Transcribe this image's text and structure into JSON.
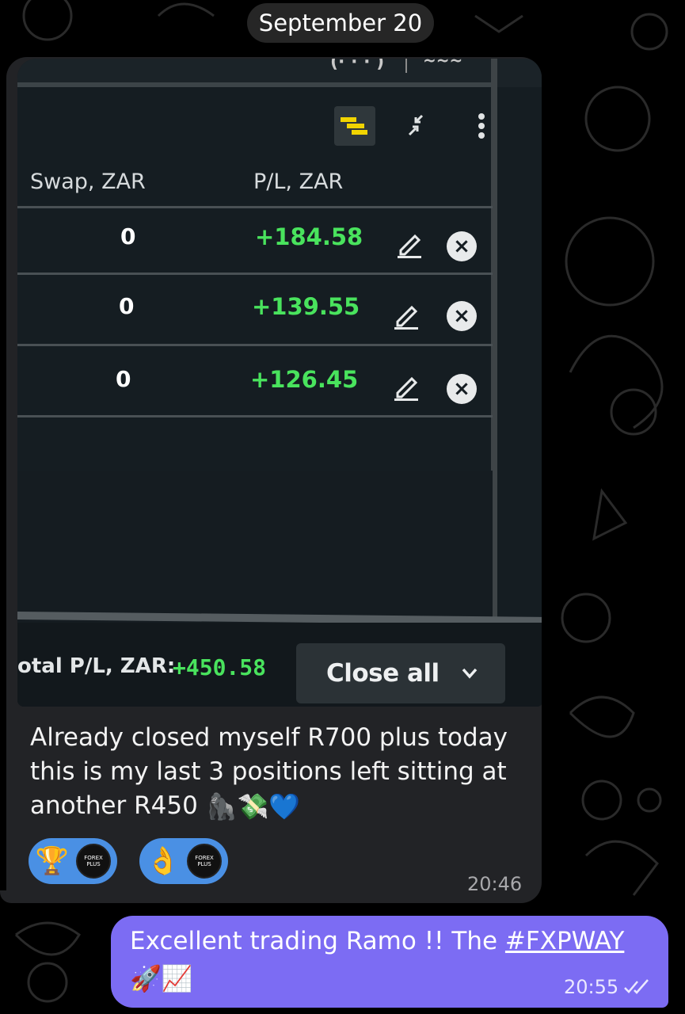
{
  "chat": {
    "date_label": "September 20",
    "incoming": {
      "screenshot": {
        "col_swap": "Swap, ZAR",
        "col_pl": "P/L, ZAR",
        "rows": [
          {
            "swap": "0",
            "pl": "+184.58"
          },
          {
            "swap": "0",
            "pl": "+139.55"
          },
          {
            "swap": "0",
            "pl": "+126.45"
          }
        ],
        "total_label": "otal P/L, ZAR:",
        "total_value": "+450.58",
        "close_all_label": "Close all"
      },
      "text": "Already closed myself R700 plus today this is my last 3 positions left sitting at another R450",
      "emojis": [
        "🦍",
        "💸",
        "💙"
      ],
      "reactions": [
        {
          "emoji": "🏆",
          "avatar_text": "FOREX PLUS"
        },
        {
          "emoji": "👌",
          "avatar_text": "FOREX PLUS"
        }
      ],
      "time": "20:46"
    },
    "outgoing": {
      "text": "Excellent trading Ramo !! The ",
      "hashtag": "#FXPWAY",
      "emojis": "🚀📈",
      "time": "20:55"
    }
  },
  "colors": {
    "background": "#000000",
    "incoming_bubble": "#222326",
    "outgoing_bubble": "#7c6cf3",
    "profit_green": "#49e35d",
    "reaction_blue": "#4a90e4"
  }
}
